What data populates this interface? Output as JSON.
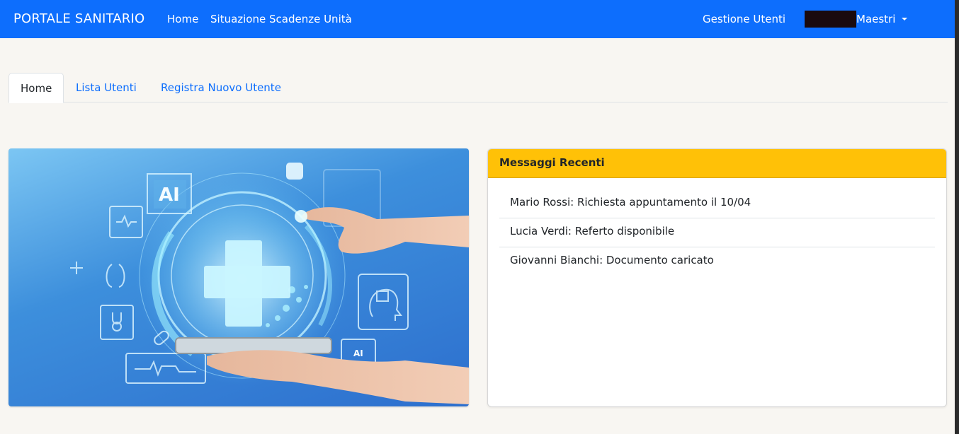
{
  "navbar": {
    "brand": "PORTALE SANITARIO",
    "links": [
      "Home",
      "Situazione Scadenze Unità"
    ],
    "admin_link": "Gestione Utenti",
    "user_name": "Maestri",
    "color": "#0d6efd"
  },
  "tabs": [
    {
      "label": "Home",
      "active": true
    },
    {
      "label": "Lista Utenti",
      "active": false
    },
    {
      "label": "Registra Nuovo Utente",
      "active": false
    }
  ],
  "hero": {
    "ai_label": "AI",
    "chip_label": "AI"
  },
  "messages": {
    "title": "Messaggi Recenti",
    "header_color": "#ffc107",
    "items": [
      "Mario Rossi: Richiesta appuntamento il 10/04",
      "Lucia Verdi: Referto disponibile",
      "Giovanni Bianchi: Documento caricato"
    ]
  }
}
